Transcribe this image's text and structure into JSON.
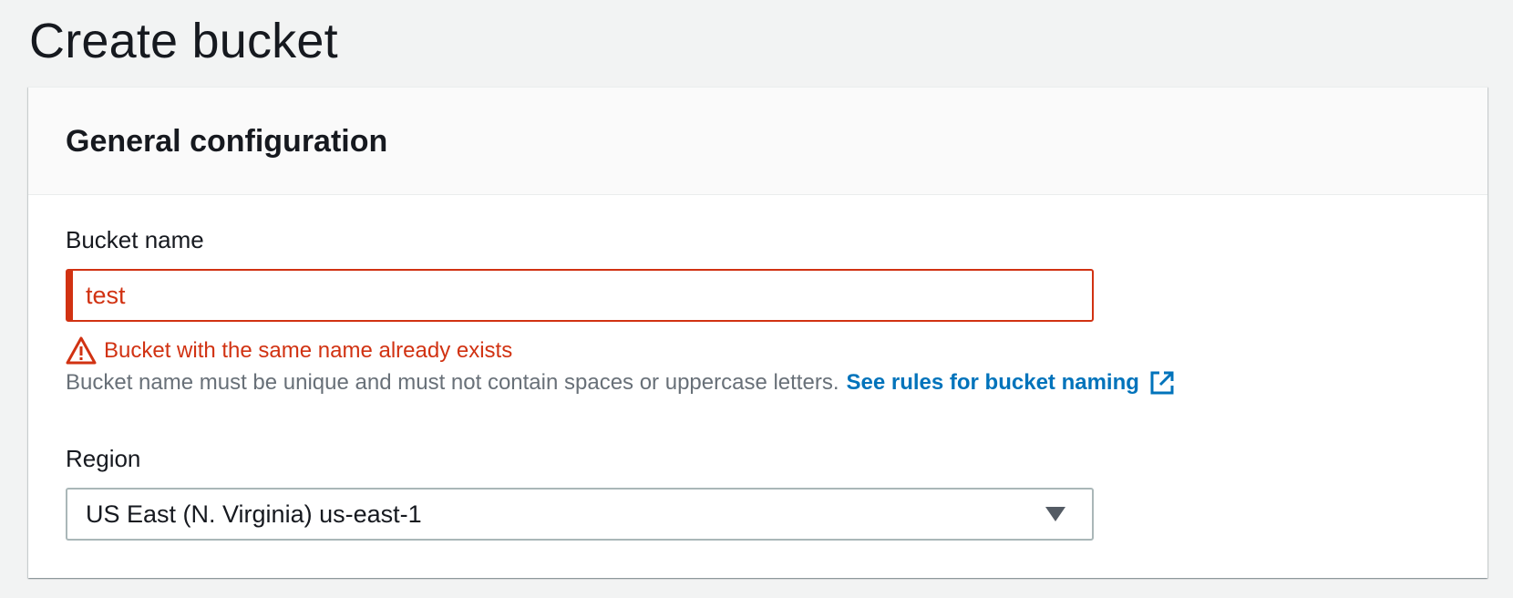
{
  "page": {
    "title": "Create bucket"
  },
  "general_configuration": {
    "title": "General configuration",
    "bucket_name": {
      "label": "Bucket name",
      "value": "test",
      "error_icon": "warning-icon",
      "error": "Bucket with the same name already exists",
      "hint": "Bucket name must be unique and must not contain spaces or uppercase letters.",
      "rules_link": "See rules for bucket naming",
      "link_icon": "external-link-icon"
    },
    "region": {
      "label": "Region",
      "selected": "US East (N. Virginia) us-east-1",
      "caret_icon": "caret-down-icon"
    }
  },
  "colors": {
    "error": "#d13212",
    "link": "#0073bb",
    "hint": "#687078",
    "background": "#f2f3f3"
  }
}
